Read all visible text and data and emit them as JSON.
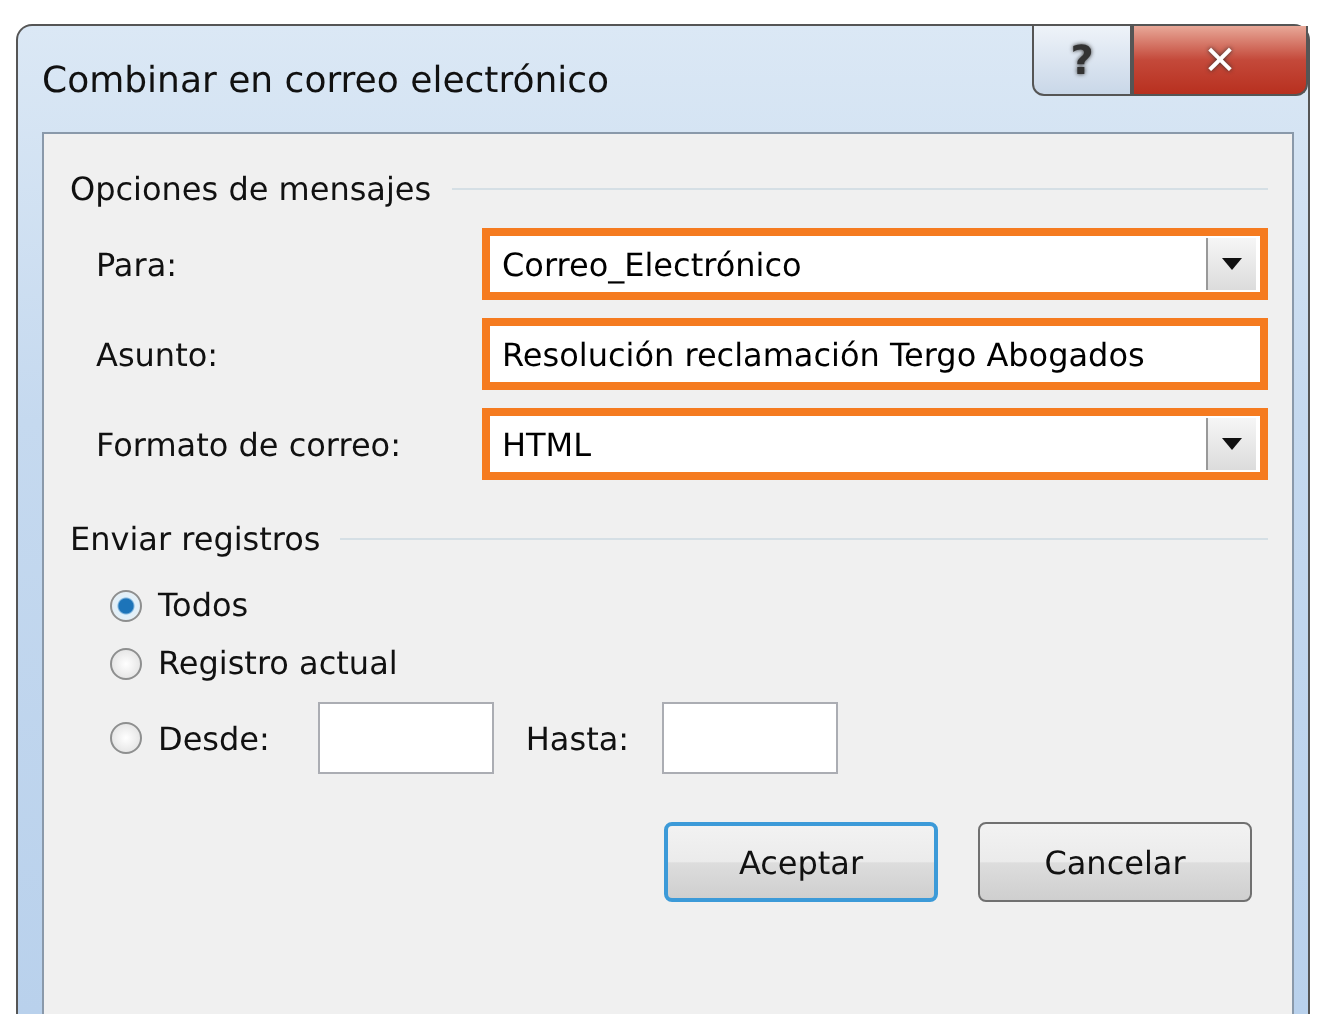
{
  "window": {
    "title": "Combinar en correo electrónico",
    "help_button": "?",
    "close_button": "✕"
  },
  "message_options": {
    "title": "Opciones de mensajes",
    "fields": [
      {
        "kind": "dropdown",
        "label": "Para:",
        "value": "Correo_Electrónico",
        "highlighted": true
      },
      {
        "kind": "text",
        "label": "Asunto:",
        "value": "Resolución reclamación Tergo Abogados",
        "highlighted": true
      },
      {
        "kind": "dropdown",
        "label": "Formato de correo:",
        "value": "HTML",
        "highlighted": true
      }
    ]
  },
  "send_records": {
    "title": "Enviar registros",
    "options": [
      {
        "kind": "plain",
        "label": "Todos",
        "selected": true
      },
      {
        "kind": "plain",
        "label": "Registro actual",
        "selected": false
      },
      {
        "kind": "range",
        "label": "Desde:",
        "to_label": "Hasta:",
        "selected": false
      }
    ]
  },
  "buttons": [
    {
      "label": "Aceptar",
      "default": true
    },
    {
      "label": "Cancelar",
      "default": false
    }
  ]
}
